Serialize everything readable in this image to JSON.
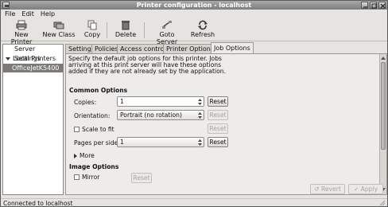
{
  "window": {
    "title": "Printer configuration - localhost"
  },
  "menu": [
    "File",
    "Edit",
    "Help"
  ],
  "toolbar": {
    "new_printer": "New Printer",
    "new_class": "New Class",
    "copy": "Copy",
    "delete": "Delete",
    "goto_server": "Goto Server",
    "refresh": "Refresh"
  },
  "sidebar": {
    "header": "Server Settings",
    "group": "Local Printers",
    "item": "OfficeJetK5400"
  },
  "tabs": [
    "Settings",
    "Policies",
    "Access control",
    "Printer Options",
    "Job Options"
  ],
  "active_tab": "Job Options",
  "content": {
    "description": "Specify the default job options for this printer. Jobs arriving at this print server will have these options added if they are not already set by the application.",
    "common_heading": "Common Options",
    "copies_label": "Copies:",
    "copies_value": "1",
    "orientation_label": "Orientation:",
    "orientation_value": "Portrait (no rotation)",
    "scale_label": "Scale to fit",
    "pages_label": "Pages per side:",
    "pages_value": "1",
    "more_label": "More",
    "image_heading": "Image Options",
    "mirror_label": "Mirror",
    "reset": "Reset"
  },
  "buttons": {
    "revert": "Revert",
    "apply": "Apply"
  },
  "status": "Connected to localhost"
}
